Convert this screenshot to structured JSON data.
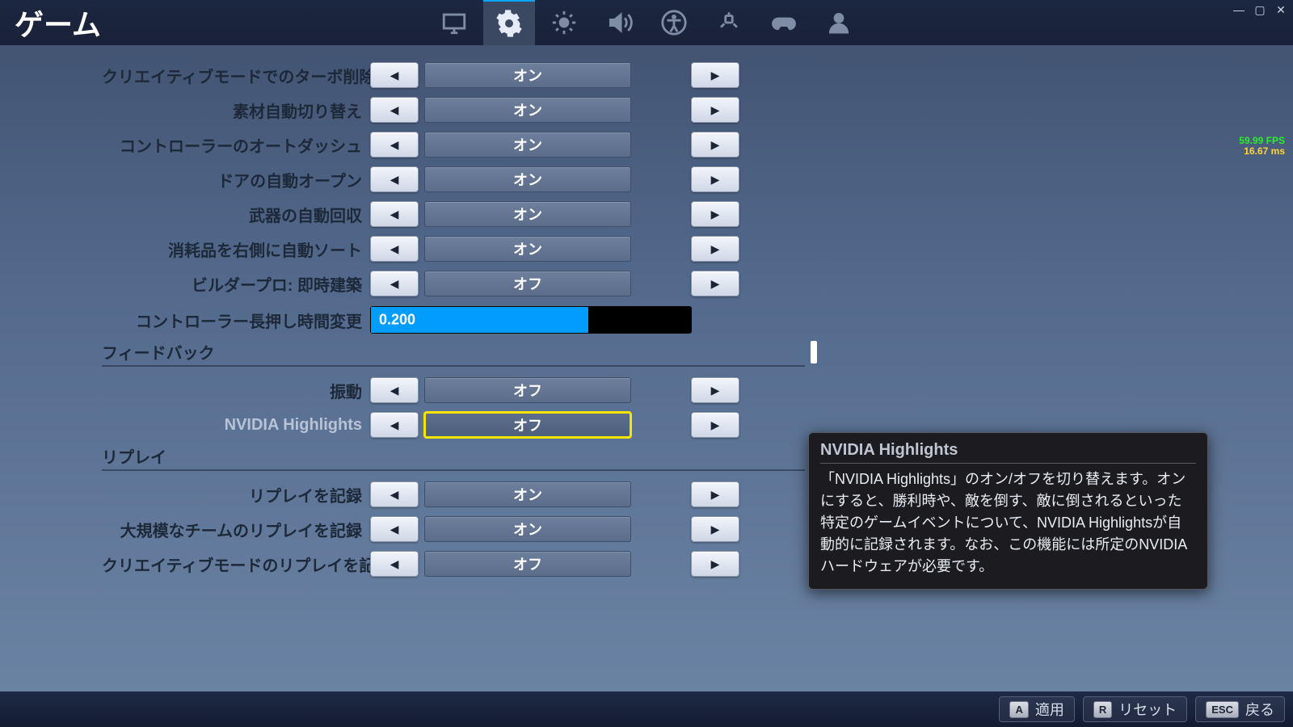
{
  "title": "ゲーム",
  "perf": {
    "fps": "59.99 FPS",
    "ms": "16.67 ms"
  },
  "rows": [
    {
      "label": "クリエイティブモードでのターボ削除",
      "value": "オン"
    },
    {
      "label": "素材自動切り替え",
      "value": "オン"
    },
    {
      "label": "コントローラーのオートダッシュ",
      "value": "オン"
    },
    {
      "label": "ドアの自動オープン",
      "value": "オン"
    },
    {
      "label": "武器の自動回収",
      "value": "オン"
    },
    {
      "label": "消耗品を右側に自動ソート",
      "value": "オン"
    },
    {
      "label": "ビルダープロ: 即時建築",
      "value": "オフ"
    }
  ],
  "slider": {
    "label": "コントローラー長押し時間変更",
    "value": "0.200"
  },
  "sections": {
    "feedback": {
      "title": "フィードバック",
      "rows": [
        {
          "label": "振動",
          "value": "オフ",
          "hl": false
        },
        {
          "label": "NVIDIA Highlights",
          "value": "オフ",
          "hl": true
        }
      ]
    },
    "replay": {
      "title": "リプレイ",
      "rows": [
        {
          "label": "リプレイを記録",
          "value": "オン"
        },
        {
          "label": "大規模なチームのリプレイを記録",
          "value": "オン"
        },
        {
          "label": "クリエイティブモードのリプレイを記録",
          "value": "オフ"
        }
      ]
    }
  },
  "tooltip": {
    "title": "NVIDIA Highlights",
    "body": "「NVIDIA Highlights」のオン/オフを切り替えます。オンにすると、勝利時や、敵を倒す、敵に倒されるといった特定のゲームイベントについて、NVIDIA Highlightsが自動的に記録されます。なお、この機能には所定のNVIDIAハードウェアが必要です。"
  },
  "footer": {
    "apply": {
      "key": "A",
      "label": "適用"
    },
    "reset": {
      "key": "R",
      "label": "リセット"
    },
    "back": {
      "key": "ESC",
      "label": "戻る"
    }
  }
}
